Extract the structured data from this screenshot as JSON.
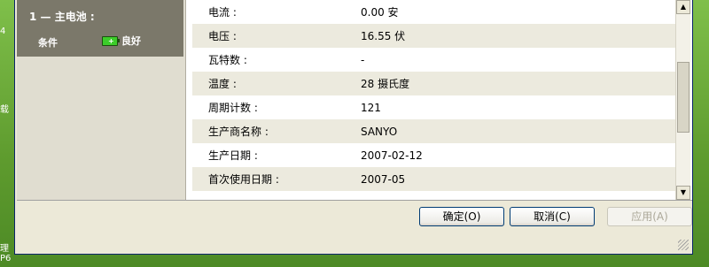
{
  "battery": {
    "title": "1 — 主电池 :",
    "condition_label": "条件",
    "condition_value": "良好"
  },
  "rows": [
    {
      "label": "电流 :",
      "value": "0.00 安"
    },
    {
      "label": "电压 :",
      "value": "16.55 伏"
    },
    {
      "label": "瓦特数 :",
      "value": "-"
    },
    {
      "label": "温度 :",
      "value": "28 摄氏度"
    },
    {
      "label": "周期计数 :",
      "value": "121"
    },
    {
      "label": "生产商名称 :",
      "value": "SANYO"
    },
    {
      "label": "生产日期 :",
      "value": "2007-02-12"
    },
    {
      "label": "首次使用日期 :",
      "value": "2007-05"
    }
  ],
  "buttons": {
    "ok": "确定(O)",
    "cancel": "取消(C)",
    "apply": "应用(A)"
  },
  "desktop_edge": {
    "t1": "4",
    "t2": "载",
    "t3": "理",
    "t4": "P6"
  },
  "icons": {
    "battery": "battery-icon"
  },
  "colors": {
    "sidebar_header": "#7b786a",
    "row_shade": "#eceade",
    "battery_fill": "#3ccd2a"
  }
}
